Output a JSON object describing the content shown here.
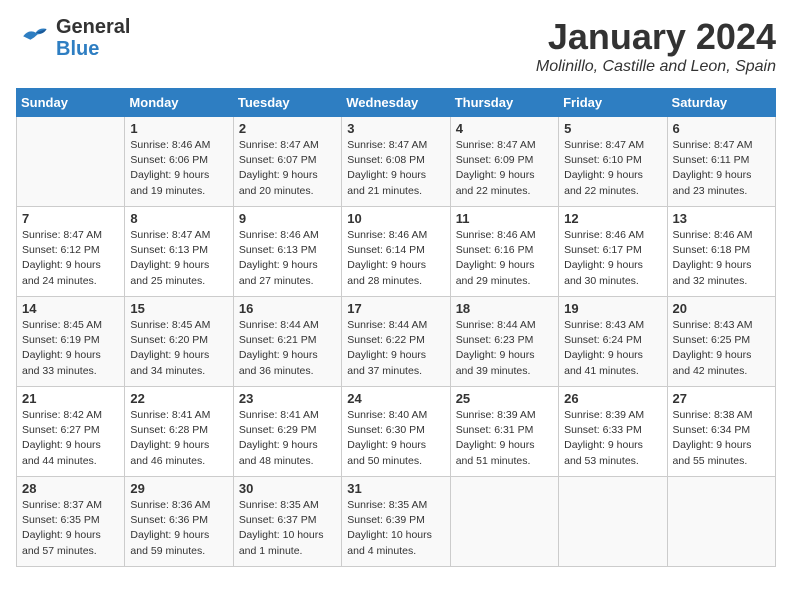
{
  "header": {
    "logo_line1": "General",
    "logo_line2": "Blue",
    "month": "January 2024",
    "location": "Molinillo, Castille and Leon, Spain"
  },
  "weekdays": [
    "Sunday",
    "Monday",
    "Tuesday",
    "Wednesday",
    "Thursday",
    "Friday",
    "Saturday"
  ],
  "weeks": [
    [
      {
        "day": "",
        "lines": []
      },
      {
        "day": "1",
        "lines": [
          "Sunrise: 8:46 AM",
          "Sunset: 6:06 PM",
          "Daylight: 9 hours",
          "and 19 minutes."
        ]
      },
      {
        "day": "2",
        "lines": [
          "Sunrise: 8:47 AM",
          "Sunset: 6:07 PM",
          "Daylight: 9 hours",
          "and 20 minutes."
        ]
      },
      {
        "day": "3",
        "lines": [
          "Sunrise: 8:47 AM",
          "Sunset: 6:08 PM",
          "Daylight: 9 hours",
          "and 21 minutes."
        ]
      },
      {
        "day": "4",
        "lines": [
          "Sunrise: 8:47 AM",
          "Sunset: 6:09 PM",
          "Daylight: 9 hours",
          "and 22 minutes."
        ]
      },
      {
        "day": "5",
        "lines": [
          "Sunrise: 8:47 AM",
          "Sunset: 6:10 PM",
          "Daylight: 9 hours",
          "and 22 minutes."
        ]
      },
      {
        "day": "6",
        "lines": [
          "Sunrise: 8:47 AM",
          "Sunset: 6:11 PM",
          "Daylight: 9 hours",
          "and 23 minutes."
        ]
      }
    ],
    [
      {
        "day": "7",
        "lines": [
          "Sunrise: 8:47 AM",
          "Sunset: 6:12 PM",
          "Daylight: 9 hours",
          "and 24 minutes."
        ]
      },
      {
        "day": "8",
        "lines": [
          "Sunrise: 8:47 AM",
          "Sunset: 6:13 PM",
          "Daylight: 9 hours",
          "and 25 minutes."
        ]
      },
      {
        "day": "9",
        "lines": [
          "Sunrise: 8:46 AM",
          "Sunset: 6:13 PM",
          "Daylight: 9 hours",
          "and 27 minutes."
        ]
      },
      {
        "day": "10",
        "lines": [
          "Sunrise: 8:46 AM",
          "Sunset: 6:14 PM",
          "Daylight: 9 hours",
          "and 28 minutes."
        ]
      },
      {
        "day": "11",
        "lines": [
          "Sunrise: 8:46 AM",
          "Sunset: 6:16 PM",
          "Daylight: 9 hours",
          "and 29 minutes."
        ]
      },
      {
        "day": "12",
        "lines": [
          "Sunrise: 8:46 AM",
          "Sunset: 6:17 PM",
          "Daylight: 9 hours",
          "and 30 minutes."
        ]
      },
      {
        "day": "13",
        "lines": [
          "Sunrise: 8:46 AM",
          "Sunset: 6:18 PM",
          "Daylight: 9 hours",
          "and 32 minutes."
        ]
      }
    ],
    [
      {
        "day": "14",
        "lines": [
          "Sunrise: 8:45 AM",
          "Sunset: 6:19 PM",
          "Daylight: 9 hours",
          "and 33 minutes."
        ]
      },
      {
        "day": "15",
        "lines": [
          "Sunrise: 8:45 AM",
          "Sunset: 6:20 PM",
          "Daylight: 9 hours",
          "and 34 minutes."
        ]
      },
      {
        "day": "16",
        "lines": [
          "Sunrise: 8:44 AM",
          "Sunset: 6:21 PM",
          "Daylight: 9 hours",
          "and 36 minutes."
        ]
      },
      {
        "day": "17",
        "lines": [
          "Sunrise: 8:44 AM",
          "Sunset: 6:22 PM",
          "Daylight: 9 hours",
          "and 37 minutes."
        ]
      },
      {
        "day": "18",
        "lines": [
          "Sunrise: 8:44 AM",
          "Sunset: 6:23 PM",
          "Daylight: 9 hours",
          "and 39 minutes."
        ]
      },
      {
        "day": "19",
        "lines": [
          "Sunrise: 8:43 AM",
          "Sunset: 6:24 PM",
          "Daylight: 9 hours",
          "and 41 minutes."
        ]
      },
      {
        "day": "20",
        "lines": [
          "Sunrise: 8:43 AM",
          "Sunset: 6:25 PM",
          "Daylight: 9 hours",
          "and 42 minutes."
        ]
      }
    ],
    [
      {
        "day": "21",
        "lines": [
          "Sunrise: 8:42 AM",
          "Sunset: 6:27 PM",
          "Daylight: 9 hours",
          "and 44 minutes."
        ]
      },
      {
        "day": "22",
        "lines": [
          "Sunrise: 8:41 AM",
          "Sunset: 6:28 PM",
          "Daylight: 9 hours",
          "and 46 minutes."
        ]
      },
      {
        "day": "23",
        "lines": [
          "Sunrise: 8:41 AM",
          "Sunset: 6:29 PM",
          "Daylight: 9 hours",
          "and 48 minutes."
        ]
      },
      {
        "day": "24",
        "lines": [
          "Sunrise: 8:40 AM",
          "Sunset: 6:30 PM",
          "Daylight: 9 hours",
          "and 50 minutes."
        ]
      },
      {
        "day": "25",
        "lines": [
          "Sunrise: 8:39 AM",
          "Sunset: 6:31 PM",
          "Daylight: 9 hours",
          "and 51 minutes."
        ]
      },
      {
        "day": "26",
        "lines": [
          "Sunrise: 8:39 AM",
          "Sunset: 6:33 PM",
          "Daylight: 9 hours",
          "and 53 minutes."
        ]
      },
      {
        "day": "27",
        "lines": [
          "Sunrise: 8:38 AM",
          "Sunset: 6:34 PM",
          "Daylight: 9 hours",
          "and 55 minutes."
        ]
      }
    ],
    [
      {
        "day": "28",
        "lines": [
          "Sunrise: 8:37 AM",
          "Sunset: 6:35 PM",
          "Daylight: 9 hours",
          "and 57 minutes."
        ]
      },
      {
        "day": "29",
        "lines": [
          "Sunrise: 8:36 AM",
          "Sunset: 6:36 PM",
          "Daylight: 9 hours",
          "and 59 minutes."
        ]
      },
      {
        "day": "30",
        "lines": [
          "Sunrise: 8:35 AM",
          "Sunset: 6:37 PM",
          "Daylight: 10 hours",
          "and 1 minute."
        ]
      },
      {
        "day": "31",
        "lines": [
          "Sunrise: 8:35 AM",
          "Sunset: 6:39 PM",
          "Daylight: 10 hours",
          "and 4 minutes."
        ]
      },
      {
        "day": "",
        "lines": []
      },
      {
        "day": "",
        "lines": []
      },
      {
        "day": "",
        "lines": []
      }
    ]
  ]
}
